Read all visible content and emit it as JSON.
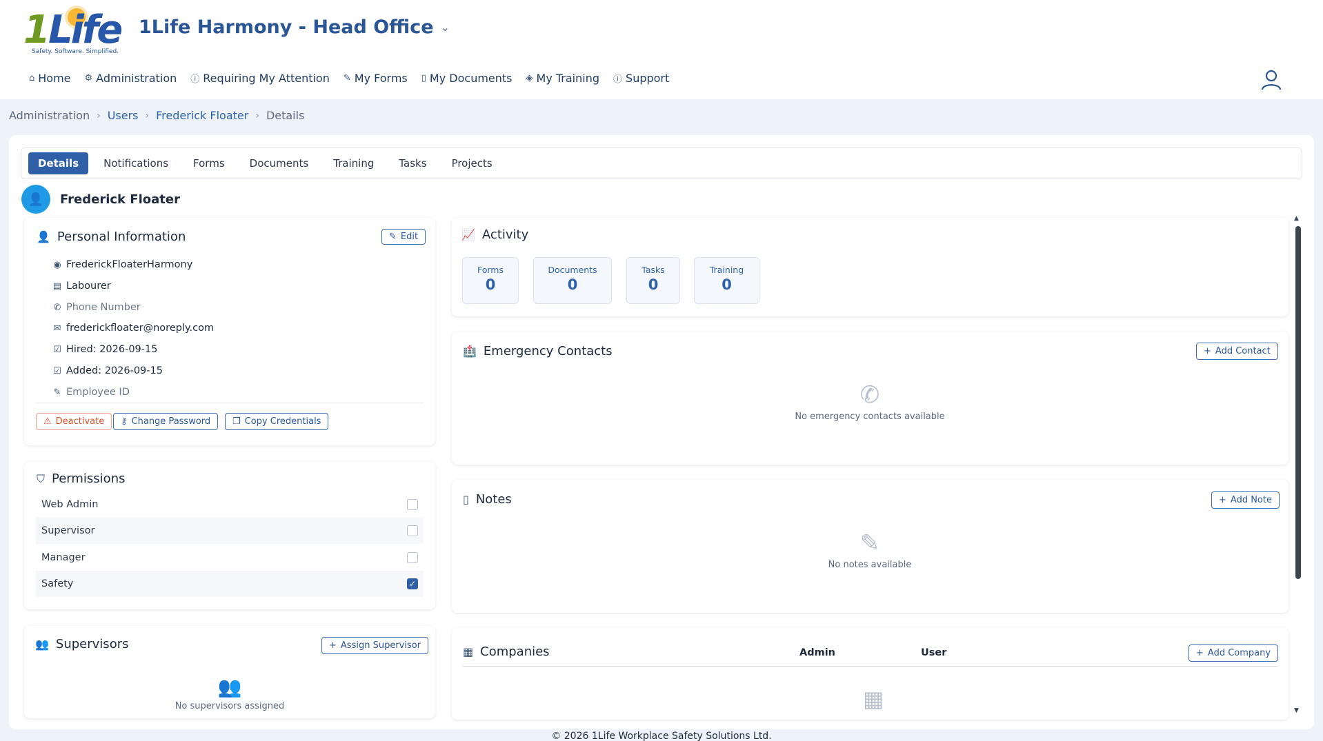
{
  "brand": {
    "logo_one": "1",
    "logo_life": "Life",
    "tagline": "Safety. Software. Simplified.",
    "org_name": "1Life Harmony - Head Office"
  },
  "nav": [
    {
      "label": "Home",
      "icon": "home-icon"
    },
    {
      "label": "Administration",
      "icon": "gear-icon"
    },
    {
      "label": "Requiring My Attention",
      "icon": "alert-icon"
    },
    {
      "label": "My Forms",
      "icon": "edit-icon"
    },
    {
      "label": "My Documents",
      "icon": "document-icon"
    },
    {
      "label": "My Training",
      "icon": "graduation-icon"
    },
    {
      "label": "Support",
      "icon": "info-icon"
    }
  ],
  "breadcrumb": [
    "Administration",
    "Users",
    "Frederick Floater",
    "Details"
  ],
  "tabs": [
    "Details",
    "Notifications",
    "Forms",
    "Documents",
    "Training",
    "Tasks",
    "Projects"
  ],
  "user": {
    "name": "Frederick Floater"
  },
  "personal": {
    "title": "Personal Information",
    "edit": "Edit",
    "username": "FrederickFloaterHarmony",
    "role": "Labourer",
    "phone_placeholder": "Phone Number",
    "email": "frederickfloater@noreply.com",
    "hired": "Hired: 2026-09-15",
    "added": "Added: 2026-09-15",
    "employee_id_placeholder": "Employee ID",
    "deactivate": "Deactivate",
    "change_password": "Change Password",
    "copy_credentials": "Copy Credentials"
  },
  "permissions": {
    "title": "Permissions",
    "items": [
      {
        "label": "Web Admin",
        "checked": false
      },
      {
        "label": "Supervisor",
        "checked": false
      },
      {
        "label": "Manager",
        "checked": false
      },
      {
        "label": "Safety",
        "checked": true
      }
    ]
  },
  "supervisors": {
    "title": "Supervisors",
    "assign": "Assign Supervisor",
    "empty": "No supervisors assigned"
  },
  "activity": {
    "title": "Activity",
    "stats": [
      {
        "label": "Forms",
        "value": "0"
      },
      {
        "label": "Documents",
        "value": "0"
      },
      {
        "label": "Tasks",
        "value": "0"
      },
      {
        "label": "Training",
        "value": "0"
      }
    ]
  },
  "emergency": {
    "title": "Emergency Contacts",
    "add": "Add Contact",
    "empty": "No emergency contacts available"
  },
  "notes": {
    "title": "Notes",
    "add": "Add Note",
    "empty": "No notes available"
  },
  "companies": {
    "title": "Companies",
    "col_admin": "Admin",
    "col_user": "User",
    "add": "Add Company"
  },
  "footer": "© 2026 1Life Workplace Safety Solutions Ltd."
}
